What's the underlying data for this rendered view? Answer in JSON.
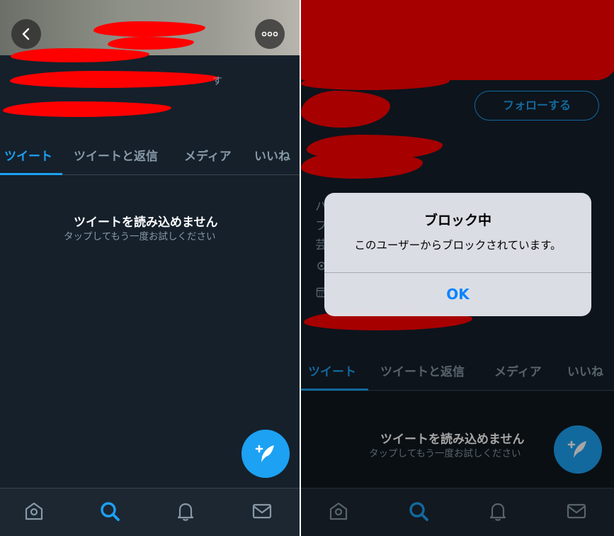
{
  "left": {
    "tabs": [
      {
        "label": "ツイート",
        "active": true
      },
      {
        "label": "ツイートと返信",
        "active": false
      },
      {
        "label": "メディア",
        "active": false
      },
      {
        "label": "いいね",
        "active": false
      }
    ],
    "empty_state": {
      "title": "ツイートを読み込めません",
      "subtitle": "タップしてもう一度お試しください"
    },
    "visible_fragments": {
      "bio_tail": "す"
    }
  },
  "right": {
    "follow_button": "フォローする",
    "tabs": [
      {
        "label": "ツイート",
        "active": true
      },
      {
        "label": "ツイートと返信",
        "active": false
      },
      {
        "label": "メディア",
        "active": false
      },
      {
        "label": "いいね",
        "active": false
      }
    ],
    "empty_state": {
      "title": "ツイートを読み込めません",
      "subtitle": "タップしてもう一度お試しください"
    },
    "alert": {
      "title": "ブロック中",
      "message": "このユーザーからブロックされています。",
      "button": "OK"
    },
    "bio_fragments": [
      "ハ",
      "フ",
      "芸"
    ]
  },
  "bottom_nav": [
    "home-icon",
    "search-icon",
    "notifications-icon",
    "messages-icon"
  ],
  "colors": {
    "background": "#15202b",
    "accent": "#1da1f2",
    "muted_text": "#8899a6",
    "redaction": "#ff0000",
    "alert_bg": "#e1e4ea",
    "alert_button": "#0a84ff"
  }
}
